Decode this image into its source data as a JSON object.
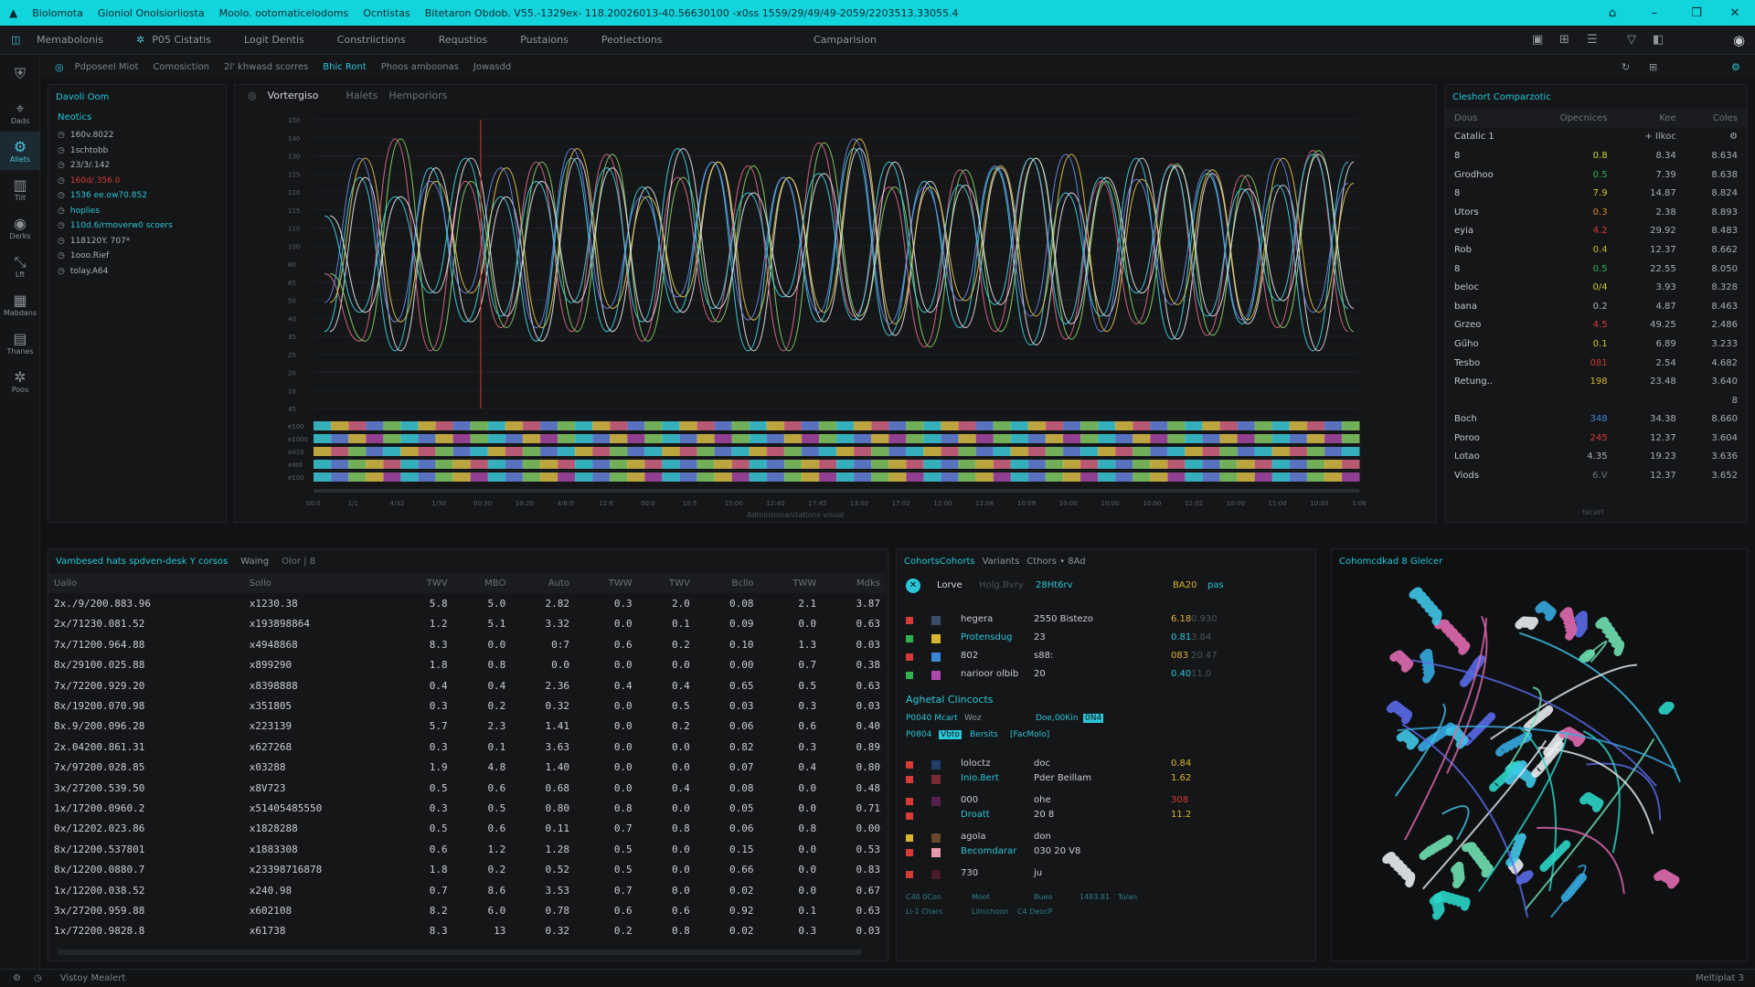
{
  "titlebar": {
    "items": [
      "Biolomota",
      "Gioniol Onolsiorliosta",
      "Moolo. ootomaticelodoms",
      "Ocntistas",
      "Bitetaron Obdob. V55.-1329ex- 118.20026013-40.56630100 -x0ss 1559/29/49/49-2059/2203513.33055.4"
    ]
  },
  "menubar": {
    "items": [
      "Memabolonis",
      "P05 Cistatis",
      "Logit Dentis",
      "Constriictions",
      "Requstios",
      "Pustaions",
      "Peotiections"
    ],
    "center": "Camparision"
  },
  "toolbar": {
    "items": [
      "Pdposeel Miot",
      "Comosiction",
      "2l' khwasd scorres",
      "Bhic Ront",
      "Phoos amboonas",
      "Jowasdd"
    ]
  },
  "rail": [
    {
      "label": "",
      "glyph": "⛨"
    },
    {
      "label": "Dads",
      "glyph": "⌖"
    },
    {
      "label": "Allets",
      "glyph": "⚙"
    },
    {
      "label": "Tilt",
      "glyph": "▥"
    },
    {
      "label": "Derks",
      "glyph": "◉"
    },
    {
      "label": "Lft",
      "glyph": "⤡"
    },
    {
      "label": "Mabdans",
      "glyph": "▦"
    },
    {
      "label": "Thanes",
      "glyph": "▤"
    },
    {
      "label": "Poos",
      "glyph": "✲"
    }
  ],
  "left_panel": {
    "title": "Davoli Oom",
    "subtitle": "Neotics",
    "items": [
      "160v.8022",
      "1schtobb",
      "23/3/.142",
      "160d/.356.0",
      "1536 ee.ow70.852",
      "hoplies",
      "110d.6/rmoverw0 scoers",
      "118120Y. 707*",
      "1ooo.Rief",
      "tolay.A64"
    ]
  },
  "chart_panel": {
    "tab_label": "Vortergiso",
    "heads": [
      "Halets",
      "Hemporiors"
    ],
    "y_ticks": [
      "150",
      "140",
      "130",
      "125",
      "120",
      "115",
      "110",
      "100",
      "80",
      "65",
      "50",
      "40",
      "35",
      "25",
      "20",
      "10",
      "45"
    ],
    "x_ticks": [
      "00:0",
      "1/1",
      "4/32",
      "1/30",
      "00:30",
      "10:20",
      "4/8:0",
      "12:6",
      "00:0",
      "10:5",
      "15:00",
      "12:40",
      "17:45",
      "13:00",
      "17:02",
      "12:00",
      "12:06",
      "10:09",
      "10:00",
      "10:00",
      "10:00",
      "12:02",
      "10:00",
      "11:00",
      "10:00",
      "1:06"
    ],
    "track_labels": [
      "e100",
      "e1000",
      "e410",
      "e4t0",
      "e100"
    ],
    "footer": "Adminsisnanitations visual"
  },
  "chart_data": {
    "type": "line",
    "title": "",
    "xlabel": "",
    "ylabel": "",
    "ylim": [
      0,
      150
    ],
    "series": [
      {
        "name": "",
        "values": [
          40,
          120,
          30,
          125,
          45,
          110,
          35,
          130,
          40,
          115,
          50,
          128,
          30,
          120,
          45,
          135,
          38,
          118,
          42,
          125,
          33,
          112,
          48,
          130,
          36,
          122,
          44,
          116,
          30,
          128
        ]
      },
      {
        "name": "",
        "values": [
          70,
          35,
          140,
          30,
          118,
          42,
          128,
          40,
          132,
          35,
          120,
          45,
          126,
          30,
          138,
          48,
          115,
          32,
          124,
          40,
          130,
          36,
          118,
          44,
          127,
          38,
          121,
          42,
          134,
          40
        ]
      },
      {
        "name": "",
        "values": [
          55,
          130,
          45,
          118,
          60,
          125,
          42,
          135,
          52,
          110,
          58,
          128,
          46,
          120,
          50,
          140,
          44,
          115,
          56,
          126,
          48,
          132,
          40,
          119,
          54,
          124,
          46,
          130,
          50,
          117
        ]
      },
      {
        "name": "",
        "values": [
          100,
          50,
          110,
          60,
          130,
          48,
          118,
          55,
          125,
          45,
          135,
          52,
          112,
          58,
          122,
          46,
          128,
          50,
          116,
          54,
          130,
          44,
          120,
          60,
          126,
          48,
          114,
          56,
          132,
          52
        ]
      }
    ]
  },
  "right_top": {
    "title": "Cleshort Comparzotic",
    "headers": [
      "Dous",
      "Opecnices",
      "Kee",
      "Coles"
    ],
    "sub": {
      "label": "Catalic 1",
      "right": "+ Ilkoc"
    },
    "rows": [
      {
        "name": "8",
        "val": "0.8",
        "c": "#c9d235",
        "a": "8.34",
        "b": "8.634"
      },
      {
        "name": "Grodhoo",
        "val": "0.5",
        "c": "#2fb24b",
        "a": "7.39",
        "b": "8.638"
      },
      {
        "name": "8",
        "val": "7.9",
        "c": "#d6c030",
        "a": "14.87",
        "b": "8.824"
      },
      {
        "name": "Utors",
        "val": "0.3",
        "c": "#d4882a",
        "a": "2.38",
        "b": "8.893"
      },
      {
        "name": "eyia",
        "val": "4.2",
        "c": "#d63b35",
        "a": "29.92",
        "b": "8.483"
      },
      {
        "name": "Rob",
        "val": "0.4",
        "c": "#c9b72c",
        "a": "12.37",
        "b": "8.662"
      },
      {
        "name": "8",
        "val": "0.5",
        "c": "#2fb24b",
        "a": "22.55",
        "b": "8.050"
      },
      {
        "name": "beloc",
        "val": "0/4",
        "c": "#c8cc34",
        "a": "3.93",
        "b": "8.328"
      },
      {
        "name": "bana",
        "val": "0.2",
        "c": "#a9adb4",
        "a": "4.87",
        "b": "8.463"
      },
      {
        "name": "Grzeo",
        "val": "4.5",
        "c": "#d63b35",
        "a": "49.25",
        "b": "2.486"
      },
      {
        "name": "Gűho",
        "val": "0.1",
        "c": "#c9c233",
        "a": "6.89",
        "b": "3.233"
      },
      {
        "name": "Tesbo",
        "val": "081",
        "c": "#c23a34",
        "a": "2.54",
        "b": "4.682"
      },
      {
        "name": "Retung..",
        "val": "198",
        "c": "#d8b62f",
        "a": "23.48",
        "b": "3.640"
      }
    ],
    "total": "8",
    "rows2": [
      {
        "name": "Boch",
        "val": "348",
        "c": "#3c86d8",
        "a": "34.38",
        "b": "8.660"
      },
      {
        "name": "Poroo",
        "val": "245",
        "c": "#d63b35",
        "a": "12.37",
        "b": "3.604"
      },
      {
        "name": "Lotao",
        "val": "4.35",
        "c": "#a9adb4",
        "a": "19.23",
        "b": "3.636"
      },
      {
        "name": "Viods",
        "val": "6.V",
        "c": "#6c7178",
        "a": "12.37",
        "b": "3.652"
      }
    ],
    "footer": "tecert"
  },
  "table_panel": {
    "title": "Vambesed hats spdven-desk Y corsos",
    "tab": "Waing",
    "filter": "Olor | 8",
    "headers": [
      "Uallo",
      "Sollo",
      "TWV",
      "MBO",
      "Auto",
      "TWW",
      "TWV",
      "Bcllo",
      "TWW",
      "Mdks"
    ],
    "rows": [
      [
        "2x./9/200.883.96",
        "x1230.38",
        "5.8",
        "5.0",
        "2.82",
        "0.3",
        "2.0",
        "0.08",
        "2.1",
        "3.87"
      ],
      [
        "2x/71230.081.52",
        "x193898864",
        "1.2",
        "5.1",
        "3.32",
        "0.0",
        "0.1",
        "0.09",
        "0.0",
        "0.63"
      ],
      [
        "7x/71200.964.88",
        "x4948868",
        "8.3",
        "0.0",
        "0:7",
        "0.6",
        "0.2",
        "0.10",
        "1.3",
        "0.03"
      ],
      [
        "8x/29100.025.88",
        "x899290",
        "1.8",
        "0.8",
        "0.0",
        "0.0",
        "0.0",
        "0.00",
        "0.7",
        "0.38"
      ],
      [
        "7x/72200.929.20",
        "x8398888",
        "0.4",
        "0.4",
        "2.36",
        "0.4",
        "0.4",
        "0.65",
        "0.5",
        "0.63"
      ],
      [
        "8x/19200.070.98",
        "x351805",
        "0.3",
        "0.2",
        "0.32",
        "0.0",
        "0.5",
        "0.03",
        "0.3",
        "0.03"
      ],
      [
        "8x.9/200.096.28",
        "x223139",
        "5.7",
        "2.3",
        "1.41",
        "0.0",
        "0.2",
        "0.06",
        "0.6",
        "0.40"
      ],
      [
        "2x.04200.861.31",
        "x627268",
        "0.3",
        "0.1",
        "3.63",
        "0.0",
        "0.0",
        "0.82",
        "0.3",
        "0.89"
      ],
      [
        "7x/97200.028.85",
        "x03288",
        "1.9",
        "4.8",
        "1.40",
        "0.0",
        "0.0",
        "0.07",
        "0.4",
        "0.80"
      ],
      [
        "3x/27200.539.50",
        "x8V723",
        "0.5",
        "0.6",
        "0.68",
        "0.0",
        "0.4",
        "0.08",
        "0.0",
        "0.48"
      ],
      [
        "1x/17200.0960.2",
        "x51405485550",
        "0.3",
        "0.5",
        "0.80",
        "0.8",
        "0.0",
        "0.05",
        "0.0",
        "0.71"
      ],
      [
        "0x/12202.023.86",
        "x1828288",
        "0.5",
        "0.6",
        "0.11",
        "0.7",
        "0.8",
        "0.06",
        "0.8",
        "0.00"
      ],
      [
        "8x/12200.537801",
        "x1883308",
        "0.6",
        "1.2",
        "1.28",
        "0.5",
        "0.0",
        "0.15",
        "0.0",
        "0.53"
      ],
      [
        "8x/12200.0880.7",
        "x23398716878",
        "1.8",
        "0.2",
        "0.52",
        "0.5",
        "0.0",
        "0.66",
        "0.0",
        "0.83"
      ],
      [
        "1x/12200.038.52",
        "x240.98",
        "0.7",
        "8.6",
        "3.53",
        "0.7",
        "0.0",
        "0.02",
        "0.0",
        "0.67"
      ],
      [
        "3x/27200.959.88",
        "x602108",
        "8.2",
        "6.0",
        "0.78",
        "0.6",
        "0.6",
        "0.92",
        "0.1",
        "0.63"
      ],
      [
        "1x/72200.9828.8",
        "x61738",
        "8.3",
        "13",
        "0.32",
        "0.2",
        "0.8",
        "0.02",
        "0.3",
        "0.03"
      ]
    ]
  },
  "cohorts_panel": {
    "title": "CohortsCohorts",
    "variants": "Variants",
    "extra": "Cthors • 8Ad",
    "filter": {
      "label": "Lorve",
      "sub": "Holg.Bvry",
      "select": "28Ht6rv",
      "right": "BA20",
      "right2": "pas"
    },
    "rows": [
      {
        "m": "#d63b35",
        "sq": "#3d4a66",
        "name": "hegera",
        "v": "2550 Bistezo",
        "nc": "#c9ccd2",
        "r": "6.18",
        "r2": "0.930",
        "rc": "#e0b13a"
      },
      {
        "m": "#2fb24b",
        "sq": "#d8b62f",
        "name": "Protensdug",
        "v": "23",
        "nc": "#2ac7d8",
        "r": "0.81",
        "r2": "3.84",
        "rc": "#2ac7d8"
      },
      {
        "m": "#d63b35",
        "sq": "#3c86d8",
        "name": "802",
        "v": "s88:",
        "nc": "#c9ccd2",
        "r": "083",
        "r2": "20.47",
        "rc": "#e0b13a"
      },
      {
        "m": "#2fb24b",
        "sq": "#b04ab0",
        "name": "narioor olbib",
        "v": "20",
        "nc": "#c9ccd2",
        "r": "0.40",
        "r2": "11.0",
        "rc": "#2ac7d8"
      }
    ],
    "section": "Aghetal Clincocts",
    "s1": "P0040 Mcart",
    "s1b": "Woz",
    "s1c": "Doe,00Kin",
    "s1d": "0N4",
    "s2": "P0804",
    "s2b": "Vbto",
    "s2c": "Bersits",
    "s2d": "[FacMolo]",
    "rows2": [
      {
        "m": "#d63b35",
        "sq": "#1f3d66",
        "name": "loloctz",
        "v": "doc",
        "nc": "#c9ccd2",
        "r": "0.84",
        "rc": "#d8b62f"
      },
      {
        "m": "#d63b35",
        "sq": "#7a2a35",
        "name": "Inio.8ert",
        "v": "Pder Beillam",
        "nc": "#2ac7d8",
        "r": "1.62",
        "rc": "#d8b62f"
      },
      {
        "m": "#d63b35",
        "sq": "#55204a",
        "name": "000",
        "v": "ohe",
        "nc": "#c9ccd2",
        "r": "308",
        "rc": "#d63b35"
      },
      {
        "m": "#d63b35",
        "sq": "",
        "name": "Droatt",
        "v": "20 8",
        "nc": "#2ac7d8",
        "r": "11.2",
        "rc": "#d8b62f"
      },
      {
        "m": "#d8b62f",
        "sq": "#6a4a2a",
        "name": "agola",
        "v": "don",
        "nc": "#c9ccd2",
        "r": "",
        "rc": "#d8b62f"
      },
      {
        "m": "#d63b35",
        "sq": "#e79aaa",
        "name": "Becomdarar",
        "v": "030 20 V8",
        "nc": "#2ac7d8",
        "r": "",
        "rc": "#d8b62f"
      },
      {
        "m": "#d63b35",
        "sq": "#4a1a2a",
        "name": "730",
        "v": "ju",
        "nc": "#c9ccd2",
        "r": "",
        "rc": "#d8b62f"
      }
    ],
    "foot1": "C40 0Con",
    "foot2": "Moot",
    "foot3": "Bueo",
    "foot4": "1483.81",
    "foot5": "To/an",
    "foot6": "Li-1 Chars",
    "foot7": "Lilnichoon",
    "foot8": "C4 DeocP"
  },
  "protein_panel": {
    "title": "Cohomcdkad 8 Glelcer"
  },
  "statusbar": {
    "text": "Vistoy Mealert",
    "right": "Meltiplat 3"
  }
}
